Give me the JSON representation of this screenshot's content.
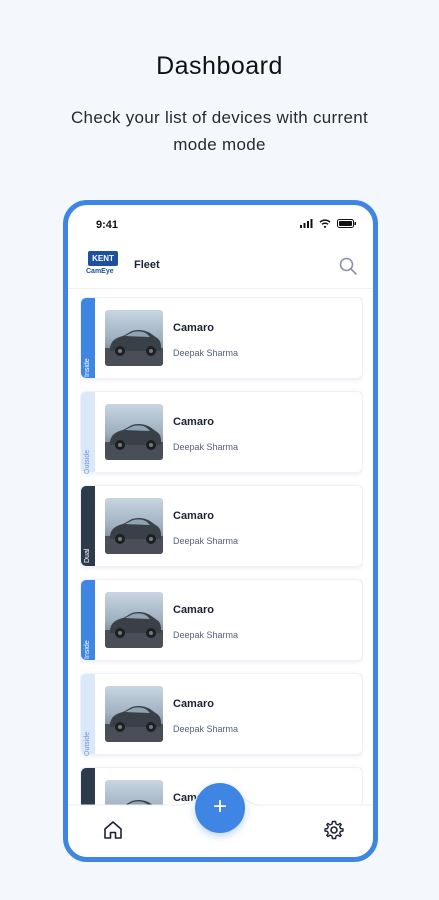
{
  "hero": {
    "title": "Dashboard",
    "subtitle": "Check your list of devices with current mode mode"
  },
  "status_bar": {
    "time": "9:41"
  },
  "header": {
    "logo_text": "KENT",
    "logo_subtext": "CamEye",
    "title": "Fleet"
  },
  "mode_colors": {
    "Inside": {
      "bg": "#3f86e4",
      "fg": "#ffffff"
    },
    "Outside": {
      "bg": "#dbe8fa",
      "fg": "#6a95d4"
    },
    "Dual": {
      "bg": "#2d3a4c",
      "fg": "#ffffff"
    }
  },
  "devices": [
    {
      "mode": "Inside",
      "name": "Camaro",
      "owner": "Deepak Sharma"
    },
    {
      "mode": "Outside",
      "name": "Camaro",
      "owner": "Deepak Sharma"
    },
    {
      "mode": "Dual",
      "name": "Camaro",
      "owner": "Deepak Sharma"
    },
    {
      "mode": "Inside",
      "name": "Camaro",
      "owner": "Deepak Sharma"
    },
    {
      "mode": "Outside",
      "name": "Camaro",
      "owner": "Deepak Sharma"
    },
    {
      "mode": "Dual",
      "name": "Camaro",
      "owner": ""
    }
  ],
  "nav": {
    "home_icon": "home-icon",
    "add_icon": "plus-icon",
    "settings_icon": "gear-icon",
    "fab_symbol": "+"
  }
}
